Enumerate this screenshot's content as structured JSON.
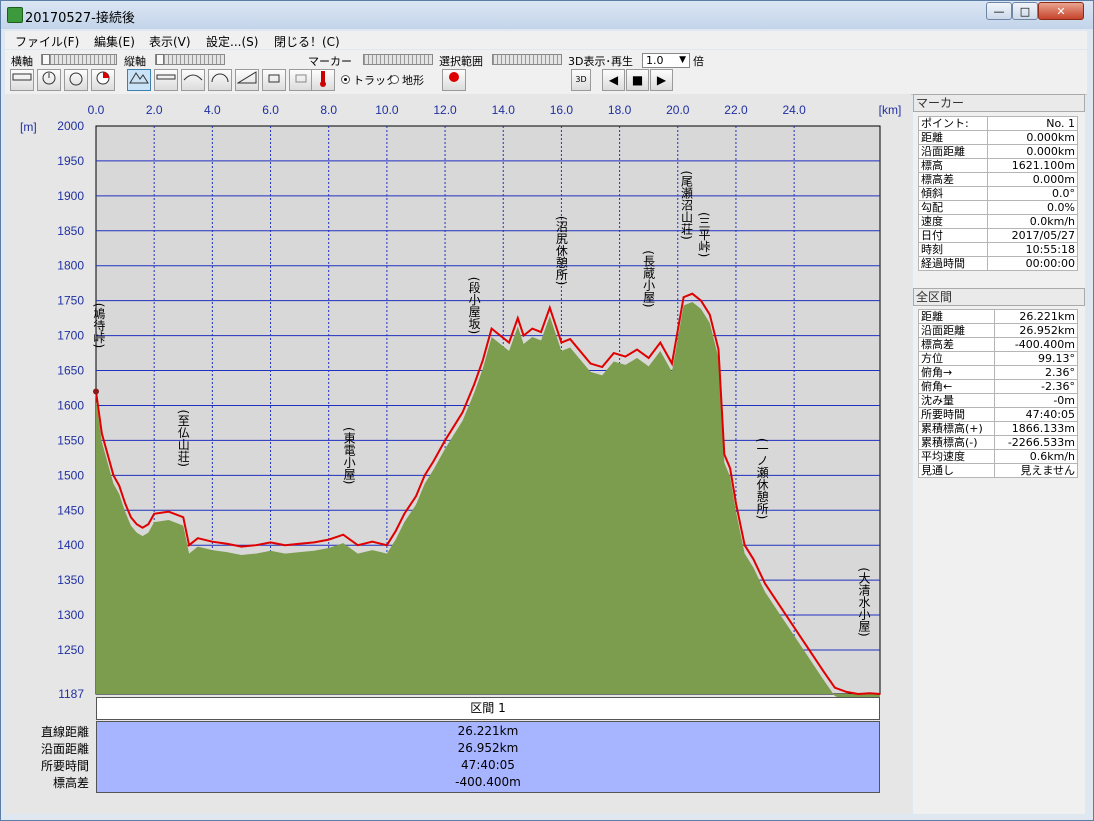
{
  "window": {
    "title": "20170527-接続後",
    "buttons": {
      "minimize": "—",
      "maximize": "□",
      "close": "✕"
    }
  },
  "menu": [
    {
      "label": "ファイル(F)"
    },
    {
      "label": "編集(E)"
    },
    {
      "label": "表示(V)"
    },
    {
      "label": "設定...(S)"
    },
    {
      "label": "閉じる！(C)"
    }
  ],
  "toolbar": {
    "h_axis": "横軸",
    "v_axis": "縦軸",
    "marker": "マーカー",
    "range": "選択範囲",
    "play3d": "3D表示･再生",
    "speed_value": "1.0",
    "speed_unit": "倍",
    "radio_track": "トラック",
    "radio_terrain": "地形",
    "btn_3d": "3D"
  },
  "chart_data": {
    "type": "area",
    "x_unit": "[km]",
    "y_unit": "[m]",
    "xlim": [
      0,
      26.952
    ],
    "ylim": [
      1187,
      2000
    ],
    "x_ticks": [
      "0.0",
      "2.0",
      "4.0",
      "6.0",
      "8.0",
      "10.0",
      "12.0",
      "14.0",
      "16.0",
      "18.0",
      "20.0",
      "22.0",
      "24.0"
    ],
    "y_ticks": [
      "2000",
      "1950",
      "1900",
      "1850",
      "1800",
      "1750",
      "1700",
      "1650",
      "1600",
      "1550",
      "1500",
      "1450",
      "1400",
      "1350",
      "1300",
      "1250",
      "1187"
    ],
    "grid": true,
    "series": [
      {
        "color": "#e00000",
        "x": [
          0,
          0.2,
          0.4,
          0.6,
          0.8,
          1.0,
          1.2,
          1.4,
          1.6,
          1.8,
          2.0,
          2.5,
          3.0,
          3.2,
          3.5,
          4.0,
          4.5,
          5.0,
          5.5,
          6.0,
          6.5,
          7.0,
          7.5,
          8.0,
          8.5,
          9.0,
          9.5,
          10.0,
          10.3,
          10.6,
          11.0,
          11.3,
          11.6,
          12.0,
          12.3,
          12.6,
          13.0,
          13.3,
          13.6,
          13.9,
          14.2,
          14.5,
          14.7,
          15.0,
          15.3,
          15.6,
          16.0,
          16.3,
          16.6,
          17.0,
          17.4,
          17.8,
          18.2,
          18.6,
          19.0,
          19.4,
          19.8,
          20.2,
          20.5,
          20.8,
          21.1,
          21.4,
          21.6,
          21.8,
          22.0,
          22.3,
          22.6,
          23.0,
          23.4,
          23.8,
          24.2,
          24.6,
          25.0,
          25.4,
          25.8,
          26.2,
          26.6,
          26.952
        ],
        "y": [
          1620,
          1560,
          1530,
          1500,
          1485,
          1460,
          1440,
          1430,
          1425,
          1430,
          1445,
          1448,
          1440,
          1400,
          1410,
          1405,
          1402,
          1398,
          1400,
          1404,
          1400,
          1402,
          1404,
          1408,
          1415,
          1400,
          1405,
          1400,
          1420,
          1445,
          1470,
          1500,
          1520,
          1550,
          1570,
          1590,
          1630,
          1665,
          1710,
          1700,
          1690,
          1725,
          1700,
          1710,
          1705,
          1740,
          1690,
          1695,
          1680,
          1660,
          1655,
          1675,
          1670,
          1680,
          1668,
          1690,
          1660,
          1755,
          1760,
          1750,
          1730,
          1680,
          1530,
          1510,
          1460,
          1400,
          1380,
          1345,
          1320,
          1295,
          1270,
          1245,
          1220,
          1196,
          1190,
          1187,
          1188,
          1187
        ]
      }
    ],
    "fill_color": "#7c9c4e",
    "annotations": [
      {
        "text": "(鳩待峠)",
        "x": 0.1
      },
      {
        "text": "(至仏山荘)",
        "x": 3.0
      },
      {
        "text": "(東電小屋)",
        "x": 8.7
      },
      {
        "text": "(段小屋坂)",
        "x": 13.0
      },
      {
        "text": "(沼尻休憩所)",
        "x": 16.0
      },
      {
        "text": "(長蔵小屋)",
        "x": 19.0
      },
      {
        "text": "(尾瀬沼山荘)",
        "x": 20.3
      },
      {
        "text": "(三平峠)",
        "x": 20.9
      },
      {
        "text": "(一ノ瀬休憩所)",
        "x": 22.9
      },
      {
        "text": "(大清水小屋)",
        "x": 26.4
      }
    ]
  },
  "segment": {
    "header": "区間 1",
    "labels": [
      "直線距離",
      "沿面距離",
      "所要時間",
      "標高差"
    ],
    "values": [
      "26.221km",
      "26.952km",
      "47:40:05",
      "-400.400m"
    ]
  },
  "marker_panel": {
    "title": "マーカー",
    "rows": [
      {
        "k": "ポイント:",
        "v": "No. 1"
      },
      {
        "k": "距離",
        "v": "0.000km"
      },
      {
        "k": "沿面距離",
        "v": "0.000km"
      },
      {
        "k": "標高",
        "v": "1621.100m"
      },
      {
        "k": "標高差",
        "v": "0.000m"
      },
      {
        "k": "傾斜",
        "v": "0.0°"
      },
      {
        "k": "勾配",
        "v": "0.0%"
      },
      {
        "k": "速度",
        "v": "0.0km/h"
      },
      {
        "k": "日付",
        "v": "2017/05/27"
      },
      {
        "k": "時刻",
        "v": "10:55:18"
      },
      {
        "k": "経過時間",
        "v": "00:00:00"
      }
    ]
  },
  "range_panel": {
    "title": "全区間",
    "rows": [
      {
        "k": "距離",
        "v": "26.221km"
      },
      {
        "k": "沿面距離",
        "v": "26.952km"
      },
      {
        "k": "標高差",
        "v": "-400.400m"
      },
      {
        "k": "方位",
        "v": "99.13°"
      },
      {
        "k": "俯角→",
        "v": "2.36°"
      },
      {
        "k": "俯角←",
        "v": "-2.36°"
      },
      {
        "k": "沈み量",
        "v": "-0m"
      },
      {
        "k": "所要時間",
        "v": "47:40:05"
      },
      {
        "k": "累積標高(+)",
        "v": "1866.133m"
      },
      {
        "k": "累積標高(-)",
        "v": "-2266.533m"
      },
      {
        "k": "平均速度",
        "v": "0.6km/h"
      },
      {
        "k": "見通し",
        "v": "見えません"
      }
    ]
  }
}
